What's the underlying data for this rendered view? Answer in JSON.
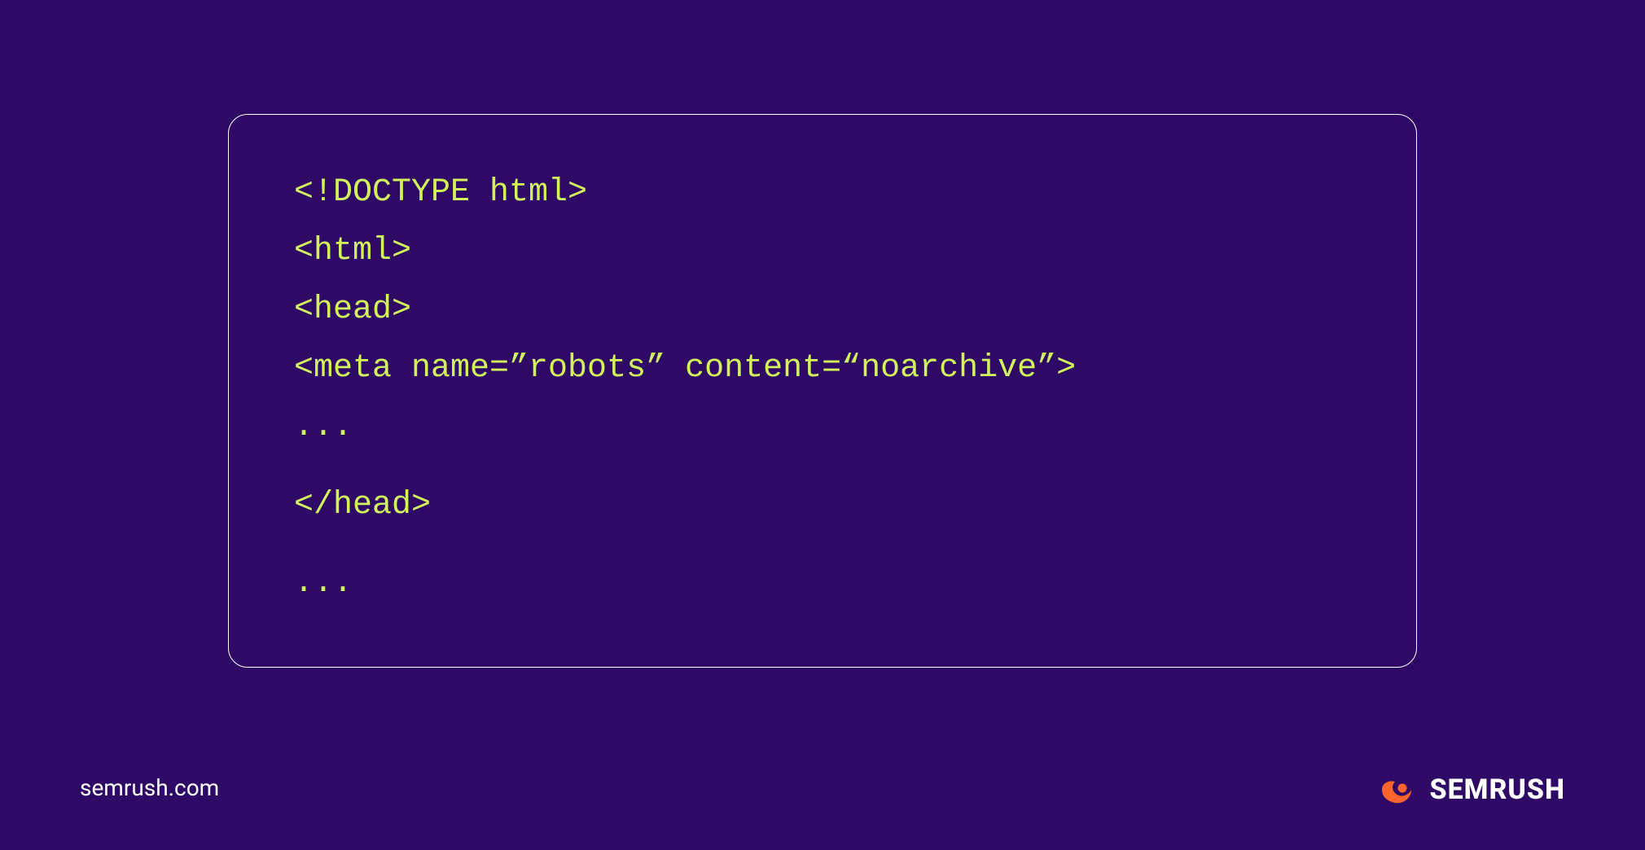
{
  "code": {
    "lines": [
      "<!DOCTYPE html>",
      "<html>",
      "<head>",
      "<meta name=”robots” content=“noarchive”>",
      "...",
      "</head>",
      "..."
    ]
  },
  "footer": {
    "url": "semrush.com",
    "brand": "SEMRUSH"
  }
}
